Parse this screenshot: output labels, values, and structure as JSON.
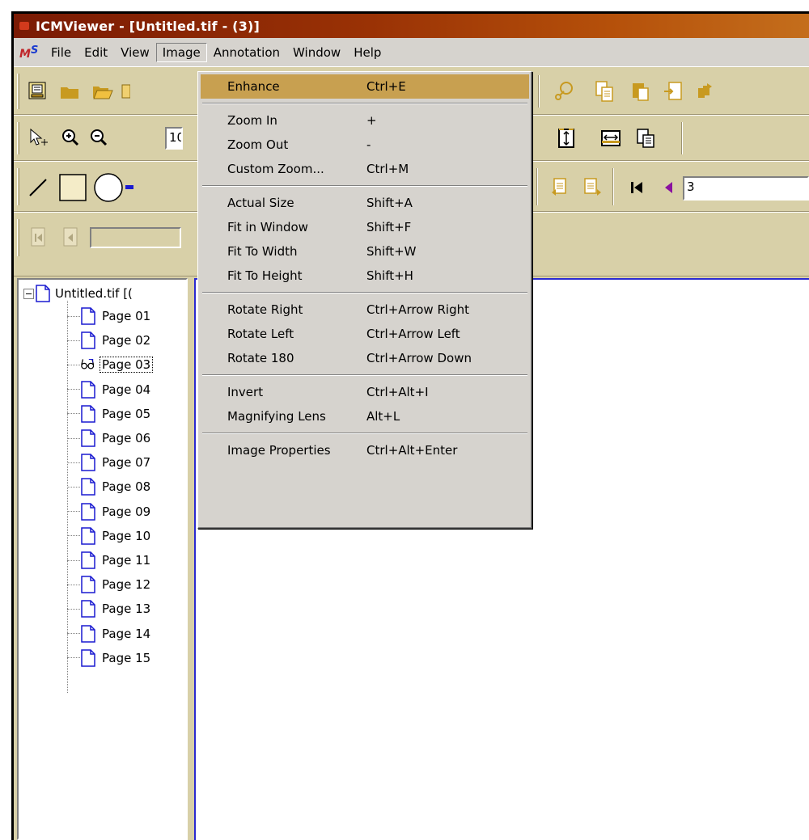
{
  "window": {
    "title": "ICMViewer - [Untitled.tif - (3)]"
  },
  "menubar": {
    "items": [
      "File",
      "Edit",
      "View",
      "Image",
      "Annotation",
      "Window",
      "Help"
    ],
    "open_menu": "Image"
  },
  "toolbar": {
    "zoom_value": "10",
    "page_value": "3"
  },
  "image_menu": {
    "groups": [
      [
        {
          "label": "Enhance",
          "shortcut": "Ctrl+E",
          "highlighted": true
        }
      ],
      [
        {
          "label": "Zoom In",
          "shortcut": "+"
        },
        {
          "label": "Zoom Out",
          "shortcut": "-"
        },
        {
          "label": "Custom Zoom...",
          "shortcut": "Ctrl+M"
        }
      ],
      [
        {
          "label": "Actual Size",
          "shortcut": "Shift+A"
        },
        {
          "label": "Fit in Window",
          "shortcut": "Shift+F"
        },
        {
          "label": "Fit To Width",
          "shortcut": "Shift+W"
        },
        {
          "label": "Fit To Height",
          "shortcut": "Shift+H"
        }
      ],
      [
        {
          "label": "Rotate Right",
          "shortcut": "Ctrl+Arrow Right"
        },
        {
          "label": "Rotate Left",
          "shortcut": "Ctrl+Arrow Left"
        },
        {
          "label": "Rotate 180",
          "shortcut": "Ctrl+Arrow Down"
        }
      ],
      [
        {
          "label": "Invert",
          "shortcut": "Ctrl+Alt+I"
        },
        {
          "label": "Magnifying Lens",
          "shortcut": "Alt+L"
        }
      ],
      [
        {
          "label": "Image Properties",
          "shortcut": "Ctrl+Alt+Enter"
        }
      ]
    ]
  },
  "tree": {
    "root_label": "Untitled.tif [(",
    "pages": [
      "Page 01",
      "Page 02",
      "Page 03",
      "Page 04",
      "Page 05",
      "Page 06",
      "Page 07",
      "Page 08",
      "Page 09",
      "Page 10",
      "Page 11",
      "Page 12",
      "Page 13",
      "Page 14",
      "Page 15"
    ],
    "selected_page": "Page 03"
  },
  "colors": {
    "title_gradient_start": "#7a1a04",
    "title_gradient_end": "#c46e1c",
    "toolbar_bg": "#d8d0a8",
    "menu_highlight": "#c8a050",
    "icon_gold": "#c89a20",
    "icon_blue": "#1a1ad0",
    "doc_border": "#2a2ad0"
  }
}
